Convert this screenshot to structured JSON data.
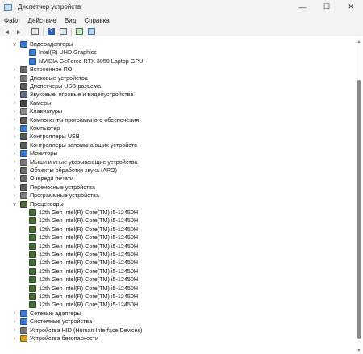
{
  "window": {
    "title": "Диспетчер устройств",
    "minimize": "—",
    "maximize": "☐",
    "close": "✕"
  },
  "menu": [
    "Файл",
    "Действие",
    "Вид",
    "Справка"
  ],
  "toolbar": [
    "back-icon",
    "forward-icon",
    "show-hide-tree-icon",
    "help-icon",
    "properties-icon",
    "update-driver-icon",
    "scan-hardware-icon"
  ],
  "tree": [
    {
      "label": "Видеоадаптеры",
      "level": 0,
      "expander": "∨",
      "icon": "display-adapter-icon",
      "color": "#3a7bd5"
    },
    {
      "label": "Intel(R) UHD Graphics",
      "level": 1,
      "expander": "",
      "icon": "display-adapter-icon",
      "color": "#3a7bd5"
    },
    {
      "label": "NVIDIA GeForce RTX 3050 Laptop GPU",
      "level": 1,
      "expander": "",
      "icon": "display-adapter-icon",
      "color": "#3a7bd5"
    },
    {
      "label": "Встроенное ПО",
      "level": 0,
      "expander": "›",
      "icon": "firmware-icon",
      "color": "#6d6d6d"
    },
    {
      "label": "Дисковые устройства",
      "level": 0,
      "expander": "›",
      "icon": "disk-drive-icon",
      "color": "#7a7a7a"
    },
    {
      "label": "Диспетчеры USB-разъема",
      "level": 0,
      "expander": "›",
      "icon": "usb-connector-icon",
      "color": "#5a5a5a"
    },
    {
      "label": "Звуковые, игровые и видеоустройства",
      "level": 0,
      "expander": "›",
      "icon": "sound-icon",
      "color": "#5a6e8a"
    },
    {
      "label": "Камеры",
      "level": 0,
      "expander": "›",
      "icon": "camera-icon",
      "color": "#444444"
    },
    {
      "label": "Клавиатуры",
      "level": 0,
      "expander": "›",
      "icon": "keyboard-icon",
      "color": "#8a8a8a"
    },
    {
      "label": "Компоненты программного обеспечения",
      "level": 0,
      "expander": "›",
      "icon": "software-component-icon",
      "color": "#5a5a5a"
    },
    {
      "label": "Компьютер",
      "level": 0,
      "expander": "›",
      "icon": "computer-icon",
      "color": "#3a7bd5"
    },
    {
      "label": "Контроллеры USB",
      "level": 0,
      "expander": "›",
      "icon": "usb-controller-icon",
      "color": "#5a5a5a"
    },
    {
      "label": "Контроллеры запоминающих устройств",
      "level": 0,
      "expander": "›",
      "icon": "storage-controller-icon",
      "color": "#5a5a5a"
    },
    {
      "label": "Мониторы",
      "level": 0,
      "expander": "›",
      "icon": "monitor-icon",
      "color": "#3a7bd5"
    },
    {
      "label": "Мыши и иные указывающие устройства",
      "level": 0,
      "expander": "›",
      "icon": "mouse-icon",
      "color": "#7a7a7a"
    },
    {
      "label": "Объекты обработки звука (APO)",
      "level": 0,
      "expander": "›",
      "icon": "audio-processing-icon",
      "color": "#6a6a6a"
    },
    {
      "label": "Очереди печати",
      "level": 0,
      "expander": "›",
      "icon": "print-queue-icon",
      "color": "#6a6a6a"
    },
    {
      "label": "Переносные устройства",
      "level": 0,
      "expander": "›",
      "icon": "portable-device-icon",
      "color": "#5a5a5a"
    },
    {
      "label": "Программные устройства",
      "level": 0,
      "expander": "›",
      "icon": "software-device-icon",
      "color": "#7a7a7a"
    },
    {
      "label": "Процессоры",
      "level": 0,
      "expander": "∨",
      "icon": "processor-icon",
      "color": "#4a6b3a"
    },
    {
      "label": "12th Gen Intel(R) Core(TM) i5-12450H",
      "level": 1,
      "expander": "",
      "icon": "processor-icon",
      "color": "#4a6b3a"
    },
    {
      "label": "12th Gen Intel(R) Core(TM) i5-12450H",
      "level": 1,
      "expander": "",
      "icon": "processor-icon",
      "color": "#4a6b3a"
    },
    {
      "label": "12th Gen Intel(R) Core(TM) i5-12450H",
      "level": 1,
      "expander": "",
      "icon": "processor-icon",
      "color": "#4a6b3a"
    },
    {
      "label": "12th Gen Intel(R) Core(TM) i5-12450H",
      "level": 1,
      "expander": "",
      "icon": "processor-icon",
      "color": "#4a6b3a"
    },
    {
      "label": "12th Gen Intel(R) Core(TM) i5-12450H",
      "level": 1,
      "expander": "",
      "icon": "processor-icon",
      "color": "#4a6b3a"
    },
    {
      "label": "12th Gen Intel(R) Core(TM) i5-12450H",
      "level": 1,
      "expander": "",
      "icon": "processor-icon",
      "color": "#4a6b3a"
    },
    {
      "label": "12th Gen Intel(R) Core(TM) i5-12450H",
      "level": 1,
      "expander": "",
      "icon": "processor-icon",
      "color": "#4a6b3a"
    },
    {
      "label": "12th Gen Intel(R) Core(TM) i5-12450H",
      "level": 1,
      "expander": "",
      "icon": "processor-icon",
      "color": "#4a6b3a"
    },
    {
      "label": "12th Gen Intel(R) Core(TM) i5-12450H",
      "level": 1,
      "expander": "",
      "icon": "processor-icon",
      "color": "#4a6b3a"
    },
    {
      "label": "12th Gen Intel(R) Core(TM) i5-12450H",
      "level": 1,
      "expander": "",
      "icon": "processor-icon",
      "color": "#4a6b3a"
    },
    {
      "label": "12th Gen Intel(R) Core(TM) i5-12450H",
      "level": 1,
      "expander": "",
      "icon": "processor-icon",
      "color": "#4a6b3a"
    },
    {
      "label": "12th Gen Intel(R) Core(TM) i5-12450H",
      "level": 1,
      "expander": "",
      "icon": "processor-icon",
      "color": "#4a6b3a"
    },
    {
      "label": "Сетевые адаптеры",
      "level": 0,
      "expander": "›",
      "icon": "network-adapter-icon",
      "color": "#3a7bd5"
    },
    {
      "label": "Системные устройства",
      "level": 0,
      "expander": "›",
      "icon": "system-device-icon",
      "color": "#3a7bd5"
    },
    {
      "label": "Устройства HID (Human Interface Devices)",
      "level": 0,
      "expander": "›",
      "icon": "hid-icon",
      "color": "#7a7a7a"
    },
    {
      "label": "Устройства безопасности",
      "level": 0,
      "expander": "›",
      "icon": "security-device-icon",
      "color": "#d4a017"
    }
  ]
}
